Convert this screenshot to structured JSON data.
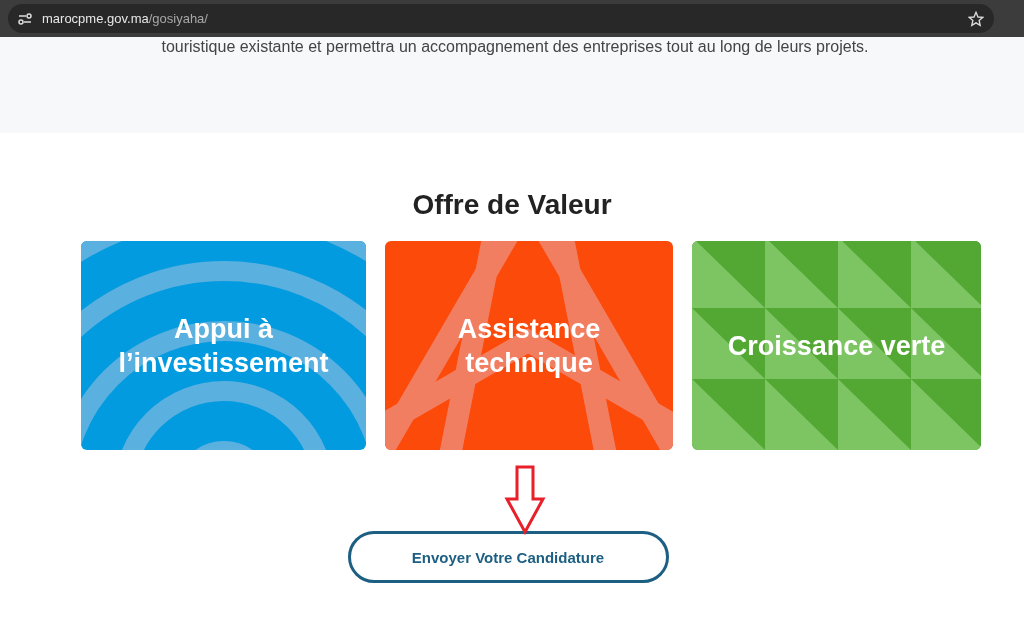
{
  "browser": {
    "url_host": "marocpme.gov.ma",
    "url_path": "/gosiyaha/"
  },
  "intro": {
    "text": "touristique existante et permettra un accompagnement des entreprises tout au long de leurs projets."
  },
  "section": {
    "title": "Offre de Valeur"
  },
  "cards": [
    {
      "kind": "arcs",
      "label": "Appui à l’investissement"
    },
    {
      "kind": "chevrons",
      "label": "Assistance technique"
    },
    {
      "kind": "triangles",
      "label": "Croissance verte"
    }
  ],
  "cta": {
    "label": "Envoyer Votre Candidature",
    "annotated": true
  }
}
